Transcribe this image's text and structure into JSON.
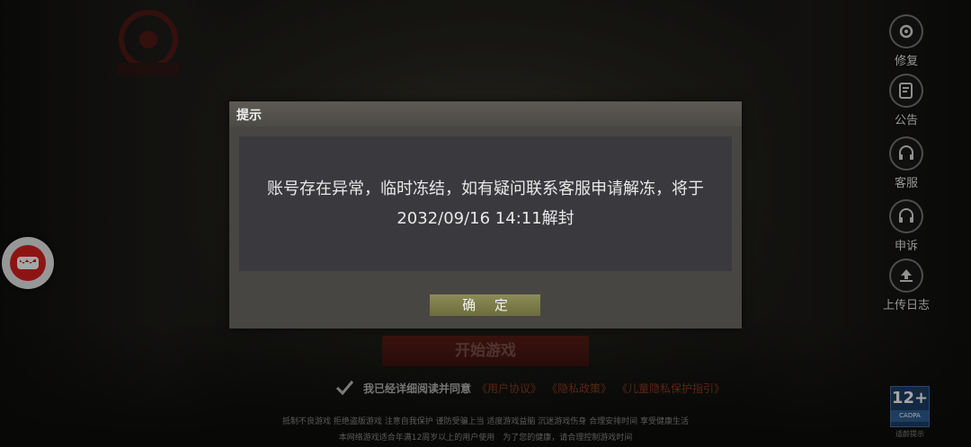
{
  "side_menu": {
    "items": [
      {
        "label": "修复",
        "icon": "gear-repair-icon"
      },
      {
        "label": "公告",
        "icon": "announcement-icon"
      },
      {
        "label": "客服",
        "icon": "headset-icon"
      },
      {
        "label": "申诉",
        "icon": "headset-appeal-icon"
      },
      {
        "label": "上传日志",
        "icon": "upload-icon"
      }
    ]
  },
  "main": {
    "start_button": "开始游戏",
    "agree_text": "我已经详细阅读并同意",
    "links": [
      "《用户协议》",
      "《隐私政策》",
      "《儿童隐私保护指引》"
    ]
  },
  "footer": {
    "line1": "抵制不良游戏 拒绝盗版游戏 注意自我保护 谨防受骗上当 适度游戏益脑 沉迷游戏伤身 合理安排时间 享受健康生活",
    "line2": "本网络游戏适合年满12周岁以上的用户使用　为了您的健康，请合理控制游戏时间"
  },
  "age_rating": {
    "number": "12+",
    "org": "CADPA",
    "tip": "适龄提示"
  },
  "dialog": {
    "title": "提示",
    "message": "账号存在异常，临时冻结，如有疑问联系客服申请解冻，将于2032/09/16 14:11解封",
    "confirm": "确 定"
  },
  "colors": {
    "accent_link": "#8a3b1e",
    "confirm_button": "#7d7e48",
    "start_button": "#4a1711"
  }
}
